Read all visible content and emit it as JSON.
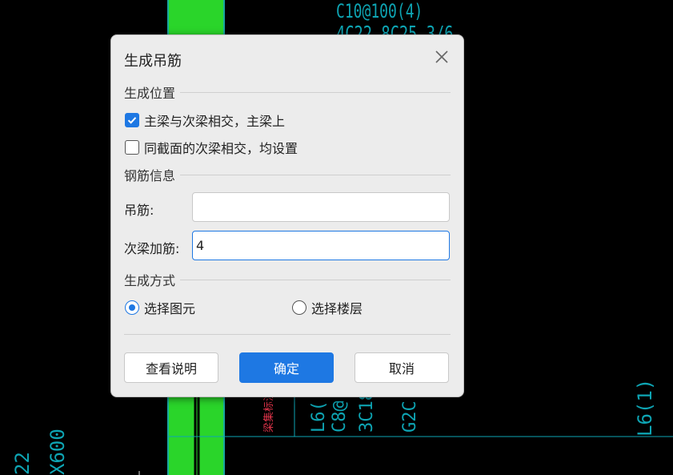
{
  "background": {
    "texts": {
      "top_a": "C10@100(4)",
      "top_b": "4C22 8C25 3/6",
      "vertical_a": "L6(",
      "vertical_b": "C8@",
      "vertical_c": "3C18",
      "vertical_d": "G2C",
      "vertical_red": "梁集标注",
      "right": "L6(1)",
      "left_a": "22",
      "left_b": "X600"
    },
    "colors": {
      "column": "#2ad52a",
      "line": "#0ea5b4",
      "text_red": "#e0344a"
    }
  },
  "dialog": {
    "title": "生成吊筋",
    "close_icon": "close-icon",
    "position_section": {
      "title": "生成位置",
      "options": [
        {
          "label": "主梁与次梁相交，主梁上",
          "checked": true
        },
        {
          "label": "同截面的次梁相交，均设置",
          "checked": false
        }
      ]
    },
    "rebar_section": {
      "title": "钢筋信息",
      "hanger_label": "吊筋:",
      "hanger_value": "",
      "secondary_label": "次梁加筋:",
      "secondary_value": "4"
    },
    "method_section": {
      "title": "生成方式",
      "options": [
        {
          "label": "选择图元",
          "selected": true
        },
        {
          "label": "选择楼层",
          "selected": false
        }
      ]
    },
    "buttons": {
      "help": "查看说明",
      "ok": "确定",
      "cancel": "取消"
    },
    "colors": {
      "accent": "#1e78e3",
      "background": "#ececec"
    }
  }
}
